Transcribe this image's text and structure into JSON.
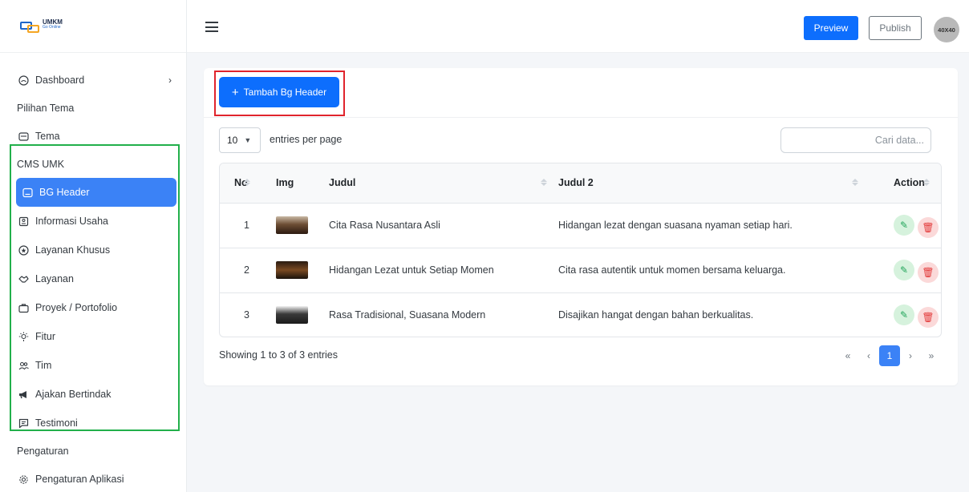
{
  "brand": {
    "line1": "UMKM",
    "line2": "Go Online"
  },
  "sidebar": {
    "dashboard": "Dashboard",
    "section_theme": "Pilihan Tema",
    "tema": "Tema",
    "section_cms": "CMS UMK",
    "items": [
      {
        "label": "BG Header",
        "icon": "image-icon"
      },
      {
        "label": "Informasi Usaha",
        "icon": "info-card-icon"
      },
      {
        "label": "Layanan Khusus",
        "icon": "star-circle-icon"
      },
      {
        "label": "Layanan",
        "icon": "handshake-icon"
      },
      {
        "label": "Proyek / Portofolio",
        "icon": "briefcase-icon"
      },
      {
        "label": "Fitur",
        "icon": "bulb-icon"
      },
      {
        "label": "Tim",
        "icon": "users-icon"
      },
      {
        "label": "Ajakan Bertindak",
        "icon": "megaphone-icon"
      },
      {
        "label": "Testimoni",
        "icon": "message-icon"
      }
    ],
    "section_settings": "Pengaturan",
    "settings_item": "Pengaturan Aplikasi"
  },
  "header": {
    "preview": "Preview",
    "publish": "Publish",
    "avatar": "40X40"
  },
  "toolbar": {
    "add_label": "Tambah Bg Header"
  },
  "controls": {
    "entries_value": "10",
    "entries_label": "entries per page",
    "search_placeholder": "Cari data..."
  },
  "table": {
    "headers": {
      "no": "No",
      "img": "Img",
      "judul": "Judul",
      "judul2": "Judul 2",
      "action": "Action"
    },
    "rows": [
      {
        "no": "1",
        "judul": "Cita Rasa Nusantara Asli",
        "judul2": "Hidangan lezat dengan suasana nyaman setiap hari."
      },
      {
        "no": "2",
        "judul": "Hidangan Lezat untuk Setiap Momen",
        "judul2": "Cita rasa autentik untuk momen bersama keluarga."
      },
      {
        "no": "3",
        "judul": "Rasa Tradisional, Suasana Modern",
        "judul2": "Disajikan hangat dengan bahan berkualitas."
      }
    ]
  },
  "footer": {
    "showing": "Showing 1 to 3 of 3 entries"
  },
  "pagination": {
    "first": "«",
    "prev": "‹",
    "current": "1",
    "next": "›",
    "last": "»"
  },
  "colors": {
    "primary": "#0d6efd",
    "active_nav": "#3b82f6",
    "highlight_green": "#22b04b",
    "highlight_red": "#e0242c"
  }
}
